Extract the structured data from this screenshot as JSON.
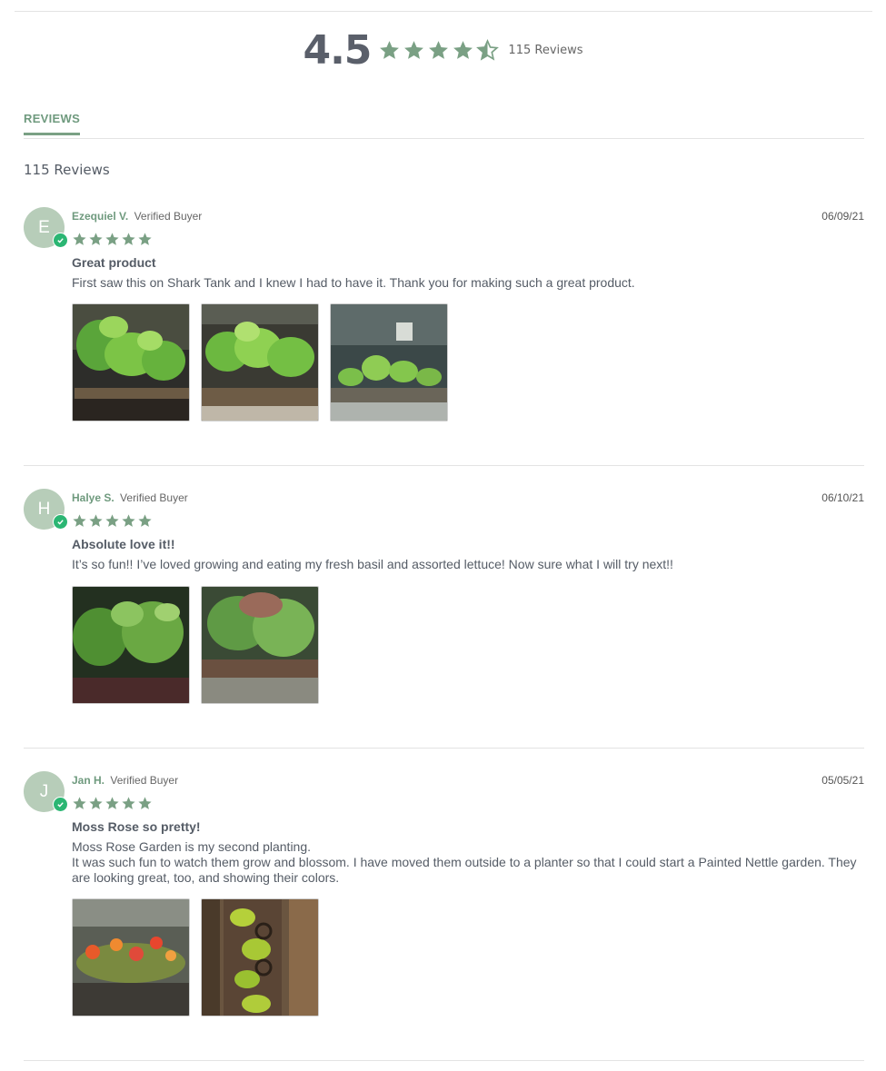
{
  "summary": {
    "average": "4.5",
    "stars": 4.5,
    "count_label": "115 Reviews"
  },
  "tabs": [
    {
      "label": "REVIEWS"
    }
  ],
  "reviews_count_label": "115 Reviews",
  "colors": {
    "accent": "#6f9a7e",
    "star": "#7aa084",
    "avatar_bg": "#b7cdb9",
    "verified_badge": "#2bb673"
  },
  "reviews": [
    {
      "initial": "E",
      "author": "Ezequiel V.",
      "badge": "Verified Buyer",
      "date": "06/09/21",
      "rating": 5,
      "title": "Great product",
      "body": [
        "First saw this on Shark Tank and I knew I had to have it. Thank you for making such a great product."
      ],
      "photos": [
        "basil-plant-photo",
        "basil-plant-photo",
        "basil-seedlings-photo"
      ]
    },
    {
      "initial": "H",
      "author": "Halye S.",
      "badge": "Verified Buyer",
      "date": "06/10/21",
      "rating": 5,
      "title": "Absolute love it!!",
      "body": [
        "It’s so fun!! I’ve loved growing and eating my fresh basil and assorted lettuce! Now sure what I will try next!!"
      ],
      "photos": [
        "basil-closeup-photo",
        "lettuce-photo"
      ]
    },
    {
      "initial": "J",
      "author": "Jan H.",
      "badge": "Verified Buyer",
      "date": "05/05/21",
      "rating": 5,
      "title": "Moss Rose so pretty!",
      "body": [
        "Moss Rose Garden is my second planting.",
        "It was such fun to watch them grow and blossom. I have moved them outside to a planter so that I could start a Painted Nettle garden. They are looking great, too, and showing their colors."
      ],
      "photos": [
        "moss-rose-photo",
        "painted-nettle-photo"
      ]
    }
  ]
}
